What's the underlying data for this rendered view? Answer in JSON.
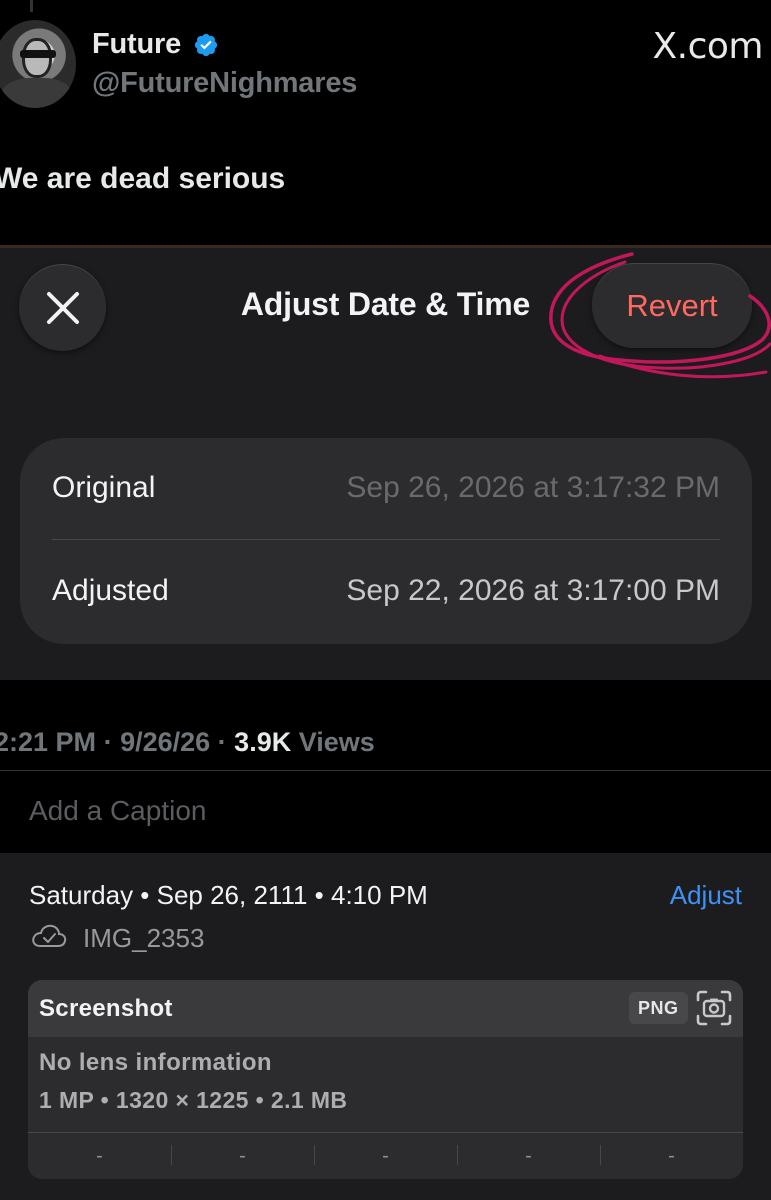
{
  "tweet": {
    "author_name": "Future",
    "author_handle": "@FutureNighmares",
    "site_logo": "X.com",
    "text": "We are dead serious",
    "meta": {
      "time": "2:21 PM",
      "date": "9/26/26",
      "views_count": "3.9K",
      "views_label": "Views"
    }
  },
  "sheet": {
    "title": "Adjust Date & Time",
    "close_icon": "close-icon",
    "revert_label": "Revert",
    "original_label": "Original",
    "original_value": "Sep 26, 2026 at 3:17:32 PM",
    "adjusted_label": "Adjusted",
    "adjusted_value": "Sep 22, 2026 at 3:17:00 PM"
  },
  "photo_info": {
    "caption_placeholder": "Add a Caption",
    "date_line": "Saturday • Sep 26, 2111 • 4:10 PM",
    "adjust_label": "Adjust",
    "file_name": "IMG_2353",
    "exif": {
      "title": "Screenshot",
      "format": "PNG",
      "lens": "No lens information",
      "specs": "1 MP  •  1320 × 1225  •  2.1 MB",
      "cells": [
        "-",
        "-",
        "-",
        "-",
        "-"
      ]
    }
  },
  "colors": {
    "revert": "#ff6961",
    "adjust_link": "#3e92f5",
    "verified": "#1d9bf0",
    "scribble": "#c2185b"
  }
}
